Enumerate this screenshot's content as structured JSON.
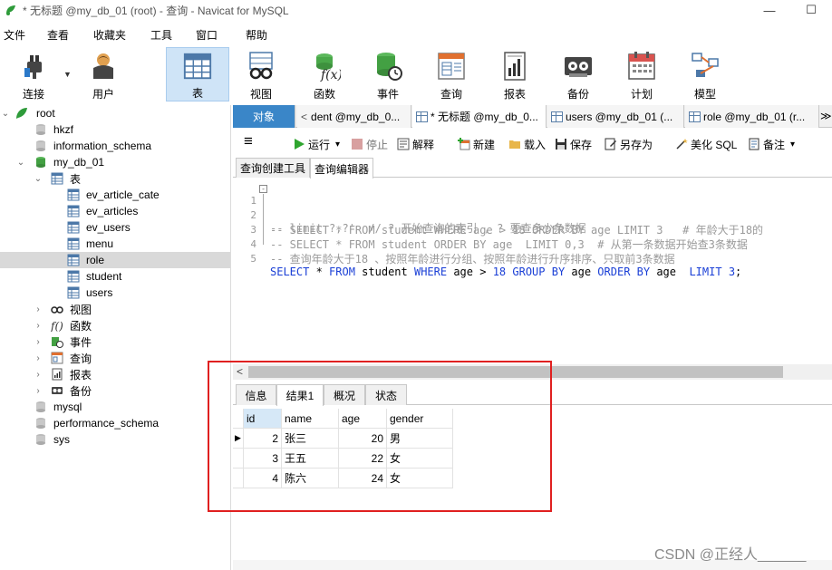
{
  "window": {
    "title": "* 无标题 @my_db_01 (root) - 查询 - Navicat for MySQL",
    "minimize_glyph": "—",
    "maximize_glyph": "☐"
  },
  "menu": [
    "文件",
    "查看",
    "收藏夹",
    "工具",
    "窗口",
    "帮助"
  ],
  "toolbar": {
    "buttons": [
      {
        "label": "连接",
        "icon": "plug-icon"
      },
      {
        "label": "用户",
        "icon": "user-icon"
      },
      {
        "label": "表",
        "icon": "table-icon"
      },
      {
        "label": "视图",
        "icon": "view-glasses-icon"
      },
      {
        "label": "函数",
        "icon": "function-icon"
      },
      {
        "label": "事件",
        "icon": "event-icon"
      },
      {
        "label": "查询",
        "icon": "query-icon"
      },
      {
        "label": "报表",
        "icon": "report-icon"
      },
      {
        "label": "备份",
        "icon": "backup-icon"
      },
      {
        "label": "计划",
        "icon": "schedule-icon"
      },
      {
        "label": "模型",
        "icon": "model-icon"
      }
    ]
  },
  "tree": {
    "items": [
      {
        "label": "root",
        "icon": "connection-icon",
        "arrow": "v"
      },
      {
        "label": "hkzf",
        "icon": "database-icon"
      },
      {
        "label": "information_schema",
        "icon": "database-icon"
      },
      {
        "label": "my_db_01",
        "icon": "database-open-icon",
        "arrow": "v"
      },
      {
        "label": "表",
        "icon": "tables-folder-icon",
        "arrow": "v"
      },
      {
        "label": "ev_article_cate",
        "icon": "table-icon"
      },
      {
        "label": "ev_articles",
        "icon": "table-icon"
      },
      {
        "label": "ev_users",
        "icon": "table-icon"
      },
      {
        "label": "menu",
        "icon": "table-icon"
      },
      {
        "label": "role",
        "icon": "table-icon"
      },
      {
        "label": "student",
        "icon": "table-icon"
      },
      {
        "label": "users",
        "icon": "table-icon"
      },
      {
        "label": "视图",
        "icon": "view-glasses-icon",
        "arrow": ">"
      },
      {
        "label": "函数",
        "icon": "function-icon",
        "arrow": ">"
      },
      {
        "label": "事件",
        "icon": "event-icon",
        "arrow": ">"
      },
      {
        "label": "查询",
        "icon": "query-icon",
        "arrow": ">"
      },
      {
        "label": "报表",
        "icon": "report-icon",
        "arrow": ">"
      },
      {
        "label": "备份",
        "icon": "backup-icon",
        "arrow": ">"
      },
      {
        "label": "mysql",
        "icon": "database-icon"
      },
      {
        "label": "performance_schema",
        "icon": "database-icon"
      },
      {
        "label": "sys",
        "icon": "database-icon"
      }
    ]
  },
  "doc_tabs": {
    "objects": "对象",
    "tabs": [
      {
        "label": "dent @my_db_0..."
      },
      {
        "label": "* 无标题 @my_db_0..."
      },
      {
        "label": "users @my_db_01 (..."
      },
      {
        "label": "role @my_db_01 (r..."
      }
    ],
    "left_arrow": "<",
    "overflow": "≫"
  },
  "editor_toolbar": {
    "menu_glyph": "≡",
    "run": "运行",
    "stop": "停止",
    "explain": "解释",
    "new": "新建",
    "load": "载入",
    "save": "保存",
    "save_as": "另存为",
    "beautify": "美化 SQL",
    "notes": "备注",
    "caret": "▾"
  },
  "sub_tabs": [
    "查询创建工具",
    "查询编辑器"
  ],
  "editor": {
    "line_numbers": [
      "1",
      "2",
      "3",
      "4",
      "5"
    ],
    "fold_glyph": "-",
    "line1": "-- limit ?,?'  // ? 开始查询的索引 , ? 要查多少条数据",
    "line2": "-- SELECT * FROM student WHERE age > 18 ORDER BY age LIMIT 3   # 年龄大于18的",
    "line3": "-- SELECT * FROM student ORDER BY age  LIMIT 0,3  # 从第一条数据开始查3条数据",
    "line4": "-- 查询年龄大于18 、按照年龄进行分组、按照年龄进行升序排序、只取前3条数据",
    "line5": {
      "select": "SELECT",
      "star": " * ",
      "from": "FROM",
      "table": " student ",
      "where": "WHERE",
      "cond": " age > ",
      "n18": "18",
      "sp": " ",
      "group": "GROUP BY",
      "col1": " age ",
      "order": "ORDER BY",
      "col2": " age  ",
      "limit": "LIMIT",
      "sp2": " ",
      "n3": "3",
      "end": ";"
    }
  },
  "scrollbar": {
    "left_arrow": "<"
  },
  "result_tabs": [
    "信息",
    "结果1",
    "概况",
    "状态"
  ],
  "grid": {
    "columns": [
      "id",
      "name",
      "age",
      "gender"
    ],
    "rows": [
      {
        "id": "2",
        "name": "张三",
        "age": "20",
        "gender": "男"
      },
      {
        "id": "3",
        "name": "王五",
        "age": "22",
        "gender": "女"
      },
      {
        "id": "4",
        "name": "陈六",
        "age": "24",
        "gender": "女"
      }
    ],
    "current_row_marker": "▶"
  },
  "watermark": "CSDN @正经人______"
}
